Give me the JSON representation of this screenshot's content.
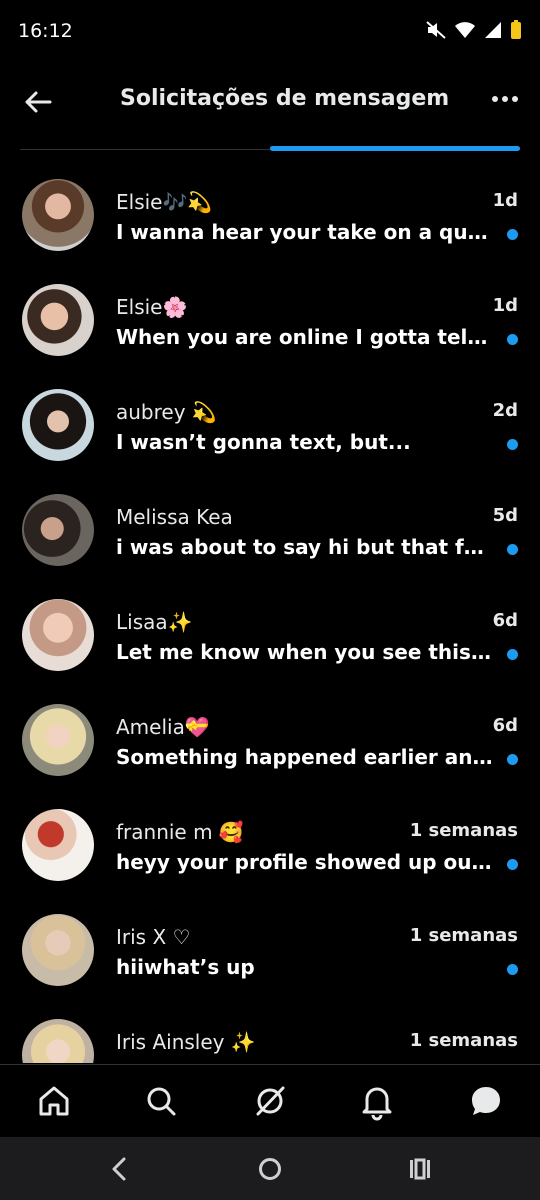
{
  "status": {
    "time": "16:12"
  },
  "header": {
    "title": "Solicitações de mensagem"
  },
  "colors": {
    "accent": "#1d9bf0",
    "background": "#000000"
  },
  "messages": [
    {
      "name": "Elsie🎶💫",
      "time": "1d",
      "preview": "I wanna hear your take on a quick thi...",
      "unread": true
    },
    {
      "name": "Elsie🌸",
      "time": "1d",
      "preview": "When you are online I gotta tell you s...",
      "unread": true
    },
    {
      "name": "aubrey 💫",
      "time": "2d",
      "preview": "I wasn’t gonna text, but...",
      "unread": true
    },
    {
      "name": "Melissa Kea",
      "time": "5d",
      "preview": "i was about to say hi but that felt too ...",
      "unread": true
    },
    {
      "name": "Lisaa✨",
      "time": "6d",
      "preview": "Let me know when you see this, I got...",
      "unread": true
    },
    {
      "name": "Amelia💝",
      "time": "6d",
      "preview": "Something happened earlier and I fel...",
      "unread": true
    },
    {
      "name": "frannie m 🥰",
      "time": "1 semanas",
      "preview": "heyy your profile showed up outta n...",
      "unread": true
    },
    {
      "name": "Iris X ♡",
      "time": "1 semanas",
      "preview": "hiiwhat’s up",
      "unread": true
    },
    {
      "name": "Iris Ainsley ✨",
      "time": "1 semanas",
      "preview": "",
      "unread": false
    }
  ],
  "nav": [
    "home-icon",
    "search-icon",
    "grok-icon",
    "bell-icon",
    "messages-icon"
  ],
  "system_nav": [
    "back-icon",
    "home-circle-icon",
    "recents-icon"
  ]
}
